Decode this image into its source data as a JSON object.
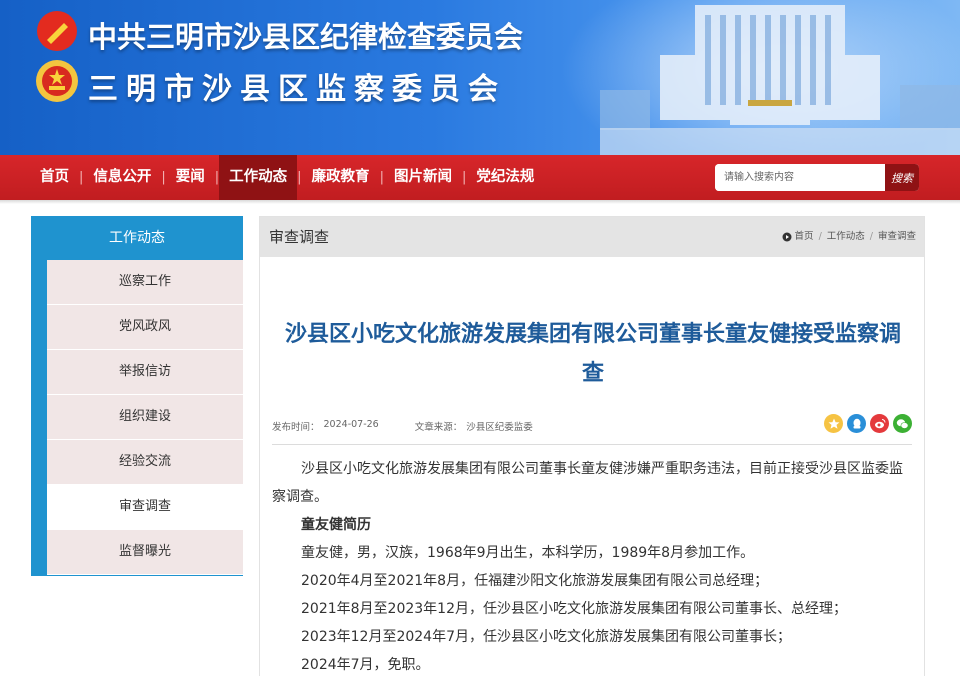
{
  "banner": {
    "title_line1": "中共三明市沙县区纪律检查委员会",
    "title_line2": "三明市沙县区监察委员会"
  },
  "nav": {
    "items": [
      {
        "label": "首页"
      },
      {
        "label": "信息公开"
      },
      {
        "label": "要闻"
      },
      {
        "label": "工作动态",
        "active": true
      },
      {
        "label": "廉政教育"
      },
      {
        "label": "图片新闻"
      },
      {
        "label": "党纪法规"
      }
    ],
    "search": {
      "placeholder": "请输入搜索内容",
      "button_label": "搜索"
    }
  },
  "sidebar": {
    "header": "工作动态",
    "items": [
      {
        "label": "巡察工作"
      },
      {
        "label": "党风政风"
      },
      {
        "label": "举报信访"
      },
      {
        "label": "组织建设"
      },
      {
        "label": "经验交流"
      },
      {
        "label": "审查调查",
        "active": true
      },
      {
        "label": "监督曝光"
      }
    ]
  },
  "panel": {
    "title": "审查调查",
    "breadcrumb": {
      "home": "首页",
      "sep": "/",
      "level1": "工作动态",
      "level2": "审查调查"
    }
  },
  "article": {
    "title": "沙县区小吃文化旅游发展集团有限公司董事长童友健接受监察调查",
    "publish_label": "发布时间：",
    "publish_date": "2024-07-26",
    "source_label": "文章来源：",
    "source": "沙县区纪委监委",
    "paragraph1": "沙县区小吃文化旅游发展集团有限公司董事长童友健涉嫌严重职务违法，目前正接受沙县区监委监察调查。",
    "bio_heading": "童友健简历",
    "bio_lines": [
      "童友健，男，汉族，1968年9月出生，本科学历，1989年8月参加工作。",
      "2020年4月至2021年8月，任福建沙阳文化旅游发展集团有限公司总经理；",
      "2021年8月至2023年12月，任沙县区小吃文化旅游发展集团有限公司董事长、总经理；",
      "2023年12月至2024年7月，任沙县区小吃文化旅游发展集团有限公司董事长；",
      "2024年7月，免职。"
    ]
  },
  "share_icons": [
    "qzone-icon",
    "qq-icon",
    "weibo-icon",
    "wechat-icon"
  ],
  "colors": {
    "banner_blue": "#1560c6",
    "nav_red": "#d7262a",
    "nav_active": "#8f1214",
    "sidebar_blue": "#1f93cf",
    "sidebar_item_bg": "#f1e6e6",
    "title_blue": "#1e5b9a"
  }
}
